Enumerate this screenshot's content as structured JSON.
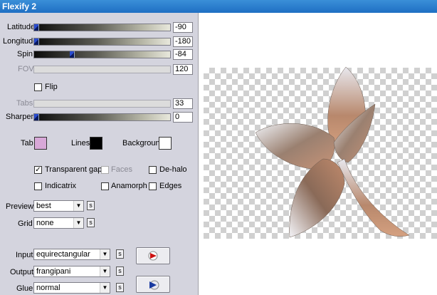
{
  "window": {
    "title": "Flexify 2"
  },
  "sliders": {
    "latitude": {
      "label": "Latitude",
      "value": "-90",
      "level": 0.0
    },
    "longitude": {
      "label": "Longitude",
      "value": "-180",
      "level": 0.0
    },
    "spin": {
      "label": "Spin",
      "value": "-84",
      "level": 0.27
    },
    "fov": {
      "label": "FOV",
      "value": "120"
    },
    "tabs": {
      "label": "Tabs",
      "value": "33"
    },
    "sharpen": {
      "label": "Sharpen",
      "value": "0",
      "level": 0.0
    }
  },
  "flip": {
    "label": "Flip",
    "checked": false
  },
  "colors": {
    "tab": {
      "label": "Tab",
      "color": "#d8a8d8"
    },
    "lines": {
      "label": "Lines",
      "color": "#000000"
    },
    "background": {
      "label": "Background",
      "color": "#ffffff"
    }
  },
  "options": {
    "transparent_gaps": {
      "label": "Transparent gaps",
      "checked": true
    },
    "faces": {
      "label": "Faces",
      "checked": false
    },
    "de_halo": {
      "label": "De-halo",
      "checked": false
    },
    "indicatrix": {
      "label": "Indicatrix",
      "checked": false
    },
    "anamorph": {
      "label": "Anamorph",
      "checked": false
    },
    "edges": {
      "label": "Edges",
      "checked": false
    }
  },
  "selects": {
    "preview": {
      "label": "Preview",
      "value": "best"
    },
    "grid": {
      "label": "Grid",
      "value": "none"
    },
    "input": {
      "label": "Input",
      "value": "equirectangular"
    },
    "output": {
      "label": "Output",
      "value": "frangipani"
    },
    "glue": {
      "label": "Glue",
      "value": "normal"
    }
  },
  "small_button_label": "s",
  "icons": {
    "input_action": "red-arrow-icon",
    "glue_action": "blue-arrow-icon"
  }
}
